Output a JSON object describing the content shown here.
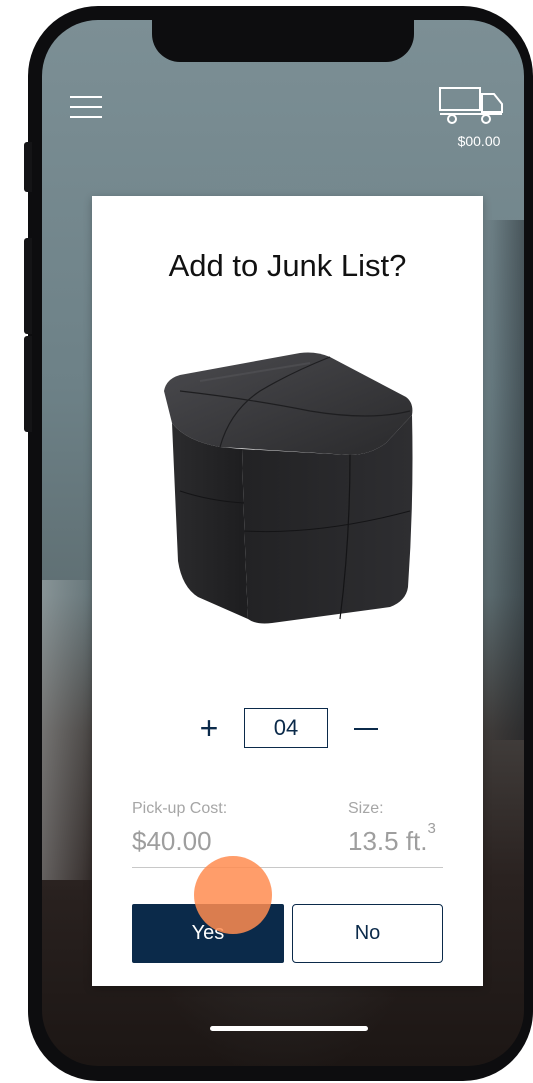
{
  "header": {
    "menu_icon": "hamburger-menu-icon",
    "truck_icon": "truck-icon",
    "cart_total": "$00.00"
  },
  "dialog": {
    "title": "Add to Junk List?",
    "item_image": "ottoman-image",
    "quantity": {
      "plus_label": "+",
      "value": "04",
      "minus_icon": "minus-icon"
    },
    "pickup_cost_label": "Pick-up Cost:",
    "pickup_cost_value": "$40.00",
    "size_label": "Size:",
    "size_value": "13.5 ft.",
    "size_unit_exponent": "3",
    "yes_label": "Yes",
    "no_label": "No"
  },
  "colors": {
    "primary_navy": "#0b2a4a",
    "tap_indicator": "#ff8c50",
    "muted_text": "#a6a6a6"
  }
}
